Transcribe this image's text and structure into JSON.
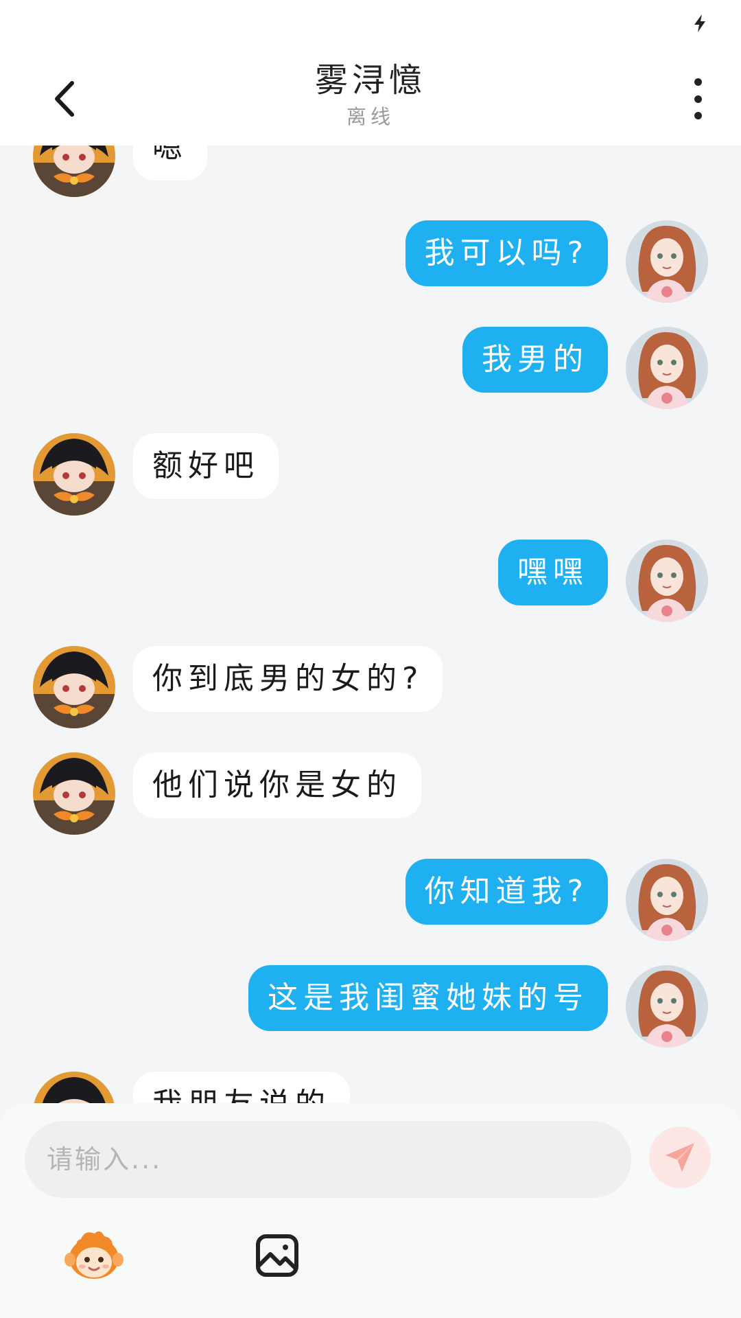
{
  "header": {
    "title": "雾浔憶",
    "status": "离线"
  },
  "messages": [
    {
      "side": "in",
      "text": "嗯"
    },
    {
      "side": "out",
      "text": "我可以吗?"
    },
    {
      "side": "out",
      "text": "我男的"
    },
    {
      "side": "in",
      "text": "额好吧"
    },
    {
      "side": "out",
      "text": "嘿嘿"
    },
    {
      "side": "in",
      "text": "你到底男的女的?"
    },
    {
      "side": "in",
      "text": "他们说你是女的"
    },
    {
      "side": "out",
      "text": "你知道我?"
    },
    {
      "side": "out",
      "text": "这是我闺蜜她妹的号"
    },
    {
      "side": "in",
      "text": "我朋友说的"
    }
  ],
  "composer": {
    "placeholder": "请输入..."
  },
  "icons": {
    "back": "chevron-left-icon",
    "more": "more-vertical-icon",
    "send": "send-icon",
    "emoji": "emoji-mascot-icon",
    "image": "image-icon",
    "status_charge": "charging-icon"
  },
  "colors": {
    "outgoing_bubble": "#1eb0f0",
    "incoming_bubble": "#ffffff",
    "background": "#f3f5f6",
    "send_button": "#fde7e4"
  }
}
